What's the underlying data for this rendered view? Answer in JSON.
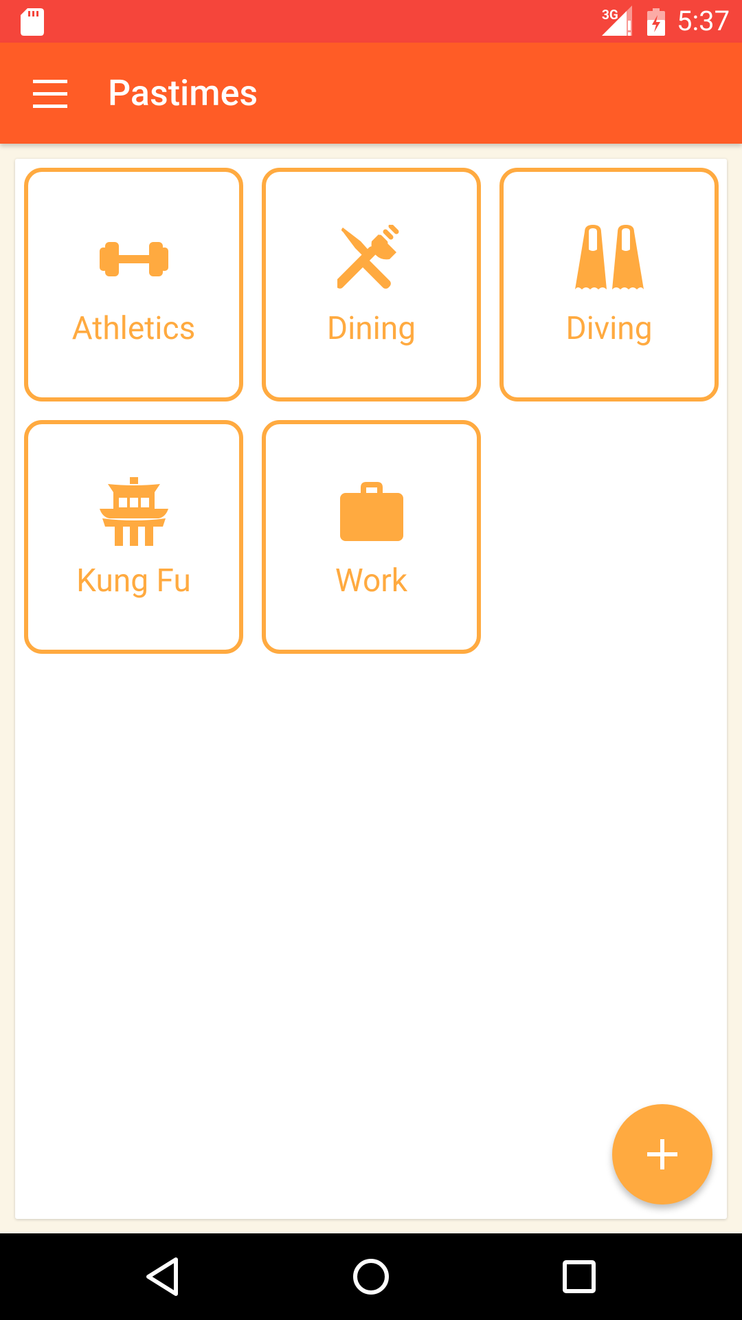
{
  "status_bar": {
    "time": "5:37",
    "network": "3G",
    "icons": [
      "sd-card-icon",
      "signal-icon",
      "battery-charging-icon"
    ]
  },
  "app_bar": {
    "menu_icon": "hamburger-menu-icon",
    "title": "Pastimes"
  },
  "tiles": [
    {
      "label": "Athletics",
      "icon": "dumbbell-icon"
    },
    {
      "label": "Dining",
      "icon": "fork-knife-icon"
    },
    {
      "label": "Diving",
      "icon": "flippers-icon"
    },
    {
      "label": "Kung Fu",
      "icon": "pagoda-icon"
    },
    {
      "label": "Work",
      "icon": "briefcase-icon"
    }
  ],
  "fab": {
    "icon": "plus-icon"
  },
  "nav_bar": {
    "buttons": [
      "back-icon",
      "home-icon",
      "recents-icon"
    ]
  },
  "colors": {
    "status_bar": "#F5453B",
    "app_bar": "#FF5C26",
    "accent": "#FFAA40",
    "background": "#FBF5E6",
    "card": "#FFFFFF"
  }
}
